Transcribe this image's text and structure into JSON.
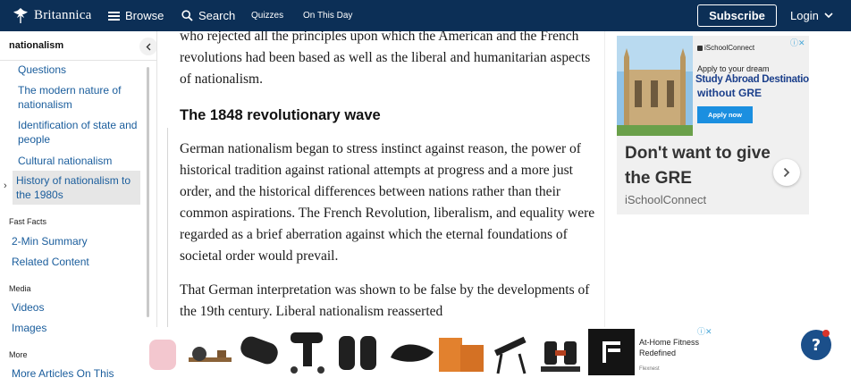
{
  "header": {
    "logo_text": "Britannica",
    "browse": "Browse",
    "search": "Search",
    "quizzes": "Quizzes",
    "on_this_day": "On This Day",
    "subscribe": "Subscribe",
    "login": "Login",
    "bg_color": "#0c2f56"
  },
  "sidebar": {
    "title": "nationalism",
    "toc": [
      {
        "label": "Questions"
      },
      {
        "label": "The modern nature of nationalism"
      },
      {
        "label": "Identification of state and people"
      },
      {
        "label": "Cultural nationalism"
      }
    ],
    "active_item": "History of nationalism to the 1980s",
    "fast_facts": {
      "heading": "Fast Facts",
      "items": [
        "2-Min Summary",
        "Related Content"
      ]
    },
    "media": {
      "heading": "Media",
      "items": [
        "Videos",
        "Images"
      ]
    },
    "more": {
      "heading": "More",
      "items": [
        "More Articles On This"
      ]
    },
    "link_color": "#1a5d9c"
  },
  "article": {
    "intro_fragment": "who rejected all the principles upon which the American and the French revolutions had been based as well as the liberal and humanitarian aspects of nationalism.",
    "section_heading": "The 1848 revolutionary wave",
    "paragraph_1": "German nationalism began to stress instinct against reason, the power of historical tradition against rational attempts at progress and a more just order, and the historical differences between nations rather than their common aspirations. The French Revolution, liberalism, and equality were regarded as a brief aberration against which the eternal foundations of societal order would prevail.",
    "paragraph_2": "That German interpretation was shown to be false by the developments of the 19th century. Liberal nationalism reasserted"
  },
  "side_ad": {
    "brand": "iSchoolConnect",
    "line1": "Apply to your dream",
    "line2": "Study Abroad Destination",
    "line3": "without GRE",
    "apply_button": "Apply now",
    "headline": "Don't want to give the GRE",
    "sub": "iSchoolConnect",
    "accent": "#1b3f8b"
  },
  "bottom_ad": {
    "title": "At-Home Fitness Redefined",
    "brand": "Flexnest",
    "products": [
      "pink-weights",
      "rowing-machine",
      "foam-roller",
      "massage-gun",
      "ankle-weights",
      "bike-saddle",
      "yoga-blocks",
      "weight-bench",
      "adjustable-dumbbell"
    ]
  }
}
